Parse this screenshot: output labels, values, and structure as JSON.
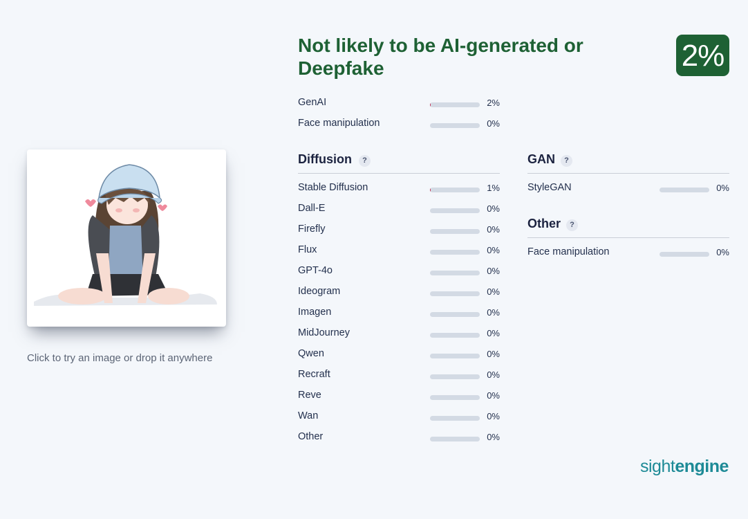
{
  "verdict": {
    "text": "Not likely to be AI-generated or Deepfake",
    "score": "2%"
  },
  "summary": [
    {
      "label": "GenAI",
      "percent": "2%",
      "value": 0.02
    },
    {
      "label": "Face manipulation",
      "percent": "0%",
      "value": 0.0
    }
  ],
  "diffusion": {
    "title": "Diffusion",
    "help": "?",
    "items": [
      {
        "label": "Stable Diffusion",
        "percent": "1%",
        "value": 0.01
      },
      {
        "label": "Dall-E",
        "percent": "0%",
        "value": 0.0
      },
      {
        "label": "Firefly",
        "percent": "0%",
        "value": 0.0
      },
      {
        "label": "Flux",
        "percent": "0%",
        "value": 0.0
      },
      {
        "label": "GPT-4o",
        "percent": "0%",
        "value": 0.0
      },
      {
        "label": "Ideogram",
        "percent": "0%",
        "value": 0.0
      },
      {
        "label": "Imagen",
        "percent": "0%",
        "value": 0.0
      },
      {
        "label": "MidJourney",
        "percent": "0%",
        "value": 0.0
      },
      {
        "label": "Qwen",
        "percent": "0%",
        "value": 0.0
      },
      {
        "label": "Recraft",
        "percent": "0%",
        "value": 0.0
      },
      {
        "label": "Reve",
        "percent": "0%",
        "value": 0.0
      },
      {
        "label": "Wan",
        "percent": "0%",
        "value": 0.0
      },
      {
        "label": "Other",
        "percent": "0%",
        "value": 0.0
      }
    ]
  },
  "gan": {
    "title": "GAN",
    "help": "?",
    "items": [
      {
        "label": "StyleGAN",
        "percent": "0%",
        "value": 0.0
      }
    ]
  },
  "other": {
    "title": "Other",
    "help": "?",
    "items": [
      {
        "label": "Face manipulation",
        "percent": "0%",
        "value": 0.0
      }
    ]
  },
  "hint": "Click to try an image or drop it anywhere",
  "logo": {
    "light": "sight",
    "bold": "engine"
  },
  "colors": {
    "verdict_green": "#1e6134",
    "bar_track": "#d3dae4",
    "bar_fill": "#c0294d",
    "brand": "#1d8a96"
  }
}
